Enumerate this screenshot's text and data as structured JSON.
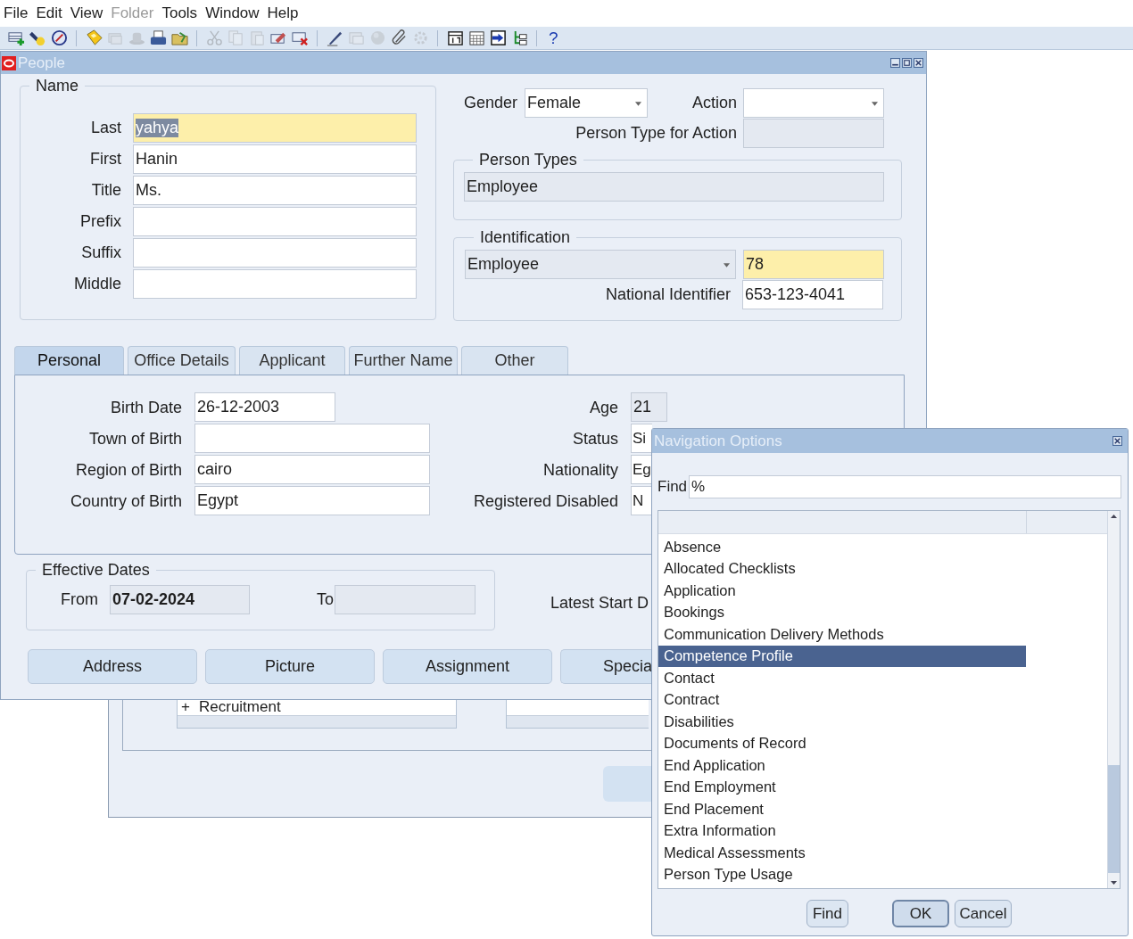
{
  "menu": [
    {
      "label": "File",
      "disabled": false
    },
    {
      "label": "Edit",
      "disabled": false
    },
    {
      "label": "View",
      "disabled": false
    },
    {
      "label": "Folder",
      "disabled": true
    },
    {
      "label": "Tools",
      "disabled": false
    },
    {
      "label": "Window",
      "disabled": false
    },
    {
      "label": "Help",
      "disabled": false
    }
  ],
  "toolbar": {
    "icons": [
      {
        "kind": "add-row",
        "disabled": false
      },
      {
        "kind": "flashlight",
        "disabled": false
      },
      {
        "kind": "compass",
        "disabled": false
      },
      {
        "kind": "separator"
      },
      {
        "kind": "floppy",
        "disabled": false
      },
      {
        "kind": "stack",
        "disabled": true
      },
      {
        "kind": "hat",
        "disabled": true
      },
      {
        "kind": "printer",
        "disabled": false
      },
      {
        "kind": "folder",
        "disabled": false
      },
      {
        "kind": "separator"
      },
      {
        "kind": "scissors",
        "disabled": true
      },
      {
        "kind": "copy",
        "disabled": true
      },
      {
        "kind": "paste",
        "disabled": true
      },
      {
        "kind": "eraser",
        "disabled": false
      },
      {
        "kind": "delete-row",
        "disabled": false
      },
      {
        "kind": "separator"
      },
      {
        "kind": "pen",
        "disabled": false
      },
      {
        "kind": "zoom",
        "disabled": true
      },
      {
        "kind": "sphere",
        "disabled": true
      },
      {
        "kind": "paperclip",
        "disabled": false
      },
      {
        "kind": "gear",
        "disabled": true
      },
      {
        "kind": "separator"
      },
      {
        "kind": "calendar",
        "disabled": false
      },
      {
        "kind": "calendar-grid",
        "disabled": false
      },
      {
        "kind": "window-arrow",
        "disabled": false
      },
      {
        "kind": "hierarchy",
        "disabled": false
      },
      {
        "kind": "separator"
      }
    ],
    "help": "?"
  },
  "people_window": {
    "title": "People",
    "name_group": {
      "title": "Name",
      "fields": [
        {
          "label": "Last",
          "value": "yahya",
          "required": true,
          "text_selected": true
        },
        {
          "label": "First",
          "value": "Hanin",
          "required": false,
          "text_selected": false
        },
        {
          "label": "Title",
          "value": "Ms.",
          "required": false,
          "text_selected": false
        },
        {
          "label": "Prefix",
          "required": false
        },
        {
          "label": "Suffix",
          "required": false
        },
        {
          "label": "Middle",
          "required": false
        }
      ]
    },
    "gender": {
      "label": "Gender",
      "value": "Female"
    },
    "action": {
      "label": "Action"
    },
    "person_type_for_action": {
      "label": "Person Type for Action"
    },
    "person_types": {
      "title": "Person Types",
      "value": "Employee"
    },
    "identification": {
      "title": "Identification",
      "type": "Employee",
      "number": "78",
      "national_label": "National Identifier",
      "national_value": "653-123-4041"
    },
    "tabs": [
      {
        "label": "Personal",
        "selected": true
      },
      {
        "label": "Office Details",
        "selected": false
      },
      {
        "label": "Applicant",
        "selected": false
      },
      {
        "label": "Further Name",
        "selected": false
      },
      {
        "label": "Other",
        "selected": false
      }
    ],
    "personal": {
      "left": [
        {
          "label": "Birth Date",
          "value": "26-12-2003",
          "kind": "date"
        },
        {
          "label": "Town of Birth",
          "kind": "text"
        },
        {
          "label": "Region of Birth",
          "value": "cairo",
          "kind": "text"
        },
        {
          "label": "Country of Birth",
          "value": "Egypt",
          "kind": "text"
        }
      ],
      "right": [
        {
          "label": "Age",
          "value": "21",
          "kind": "readonly"
        },
        {
          "label": "Status",
          "value": "Si",
          "kind": "partial"
        },
        {
          "label": "Nationality",
          "value": "Eg",
          "kind": "partial"
        },
        {
          "label": "Registered Disabled",
          "value": "N",
          "kind": "partial"
        }
      ]
    },
    "effective_dates": {
      "title": "Effective Dates",
      "from_label": "From",
      "from": "07-02-2024",
      "to_label": "To"
    },
    "latest_start_label": "Latest Start D",
    "buttons": [
      "Address",
      "Picture",
      "Assignment",
      "Specia"
    ]
  },
  "background_window": {
    "tree_item": {
      "expander": "+",
      "label": "Recruitment"
    }
  },
  "navigation_dialog": {
    "title": "Navigation Options",
    "find_label": "Find",
    "find_value": "%",
    "items": [
      {
        "label": "Absence",
        "selected": false
      },
      {
        "label": "Allocated Checklists",
        "selected": false
      },
      {
        "label": "Application",
        "selected": false
      },
      {
        "label": "Bookings",
        "selected": false
      },
      {
        "label": "Communication Delivery Methods",
        "selected": false
      },
      {
        "label": "Competence Profile",
        "selected": true
      },
      {
        "label": "Contact",
        "selected": false
      },
      {
        "label": "Contract",
        "selected": false
      },
      {
        "label": "Disabilities",
        "selected": false
      },
      {
        "label": "Documents of Record",
        "selected": false
      },
      {
        "label": "End Application",
        "selected": false
      },
      {
        "label": "End Employment",
        "selected": false
      },
      {
        "label": "End Placement",
        "selected": false
      },
      {
        "label": "Extra Information",
        "selected": false
      },
      {
        "label": "Medical Assessments",
        "selected": false
      },
      {
        "label": "Person Type Usage",
        "selected": false
      }
    ],
    "buttons": [
      {
        "label": "Find",
        "default": false
      },
      {
        "label": "OK",
        "default": true
      },
      {
        "label": "Cancel",
        "default": false
      }
    ]
  }
}
